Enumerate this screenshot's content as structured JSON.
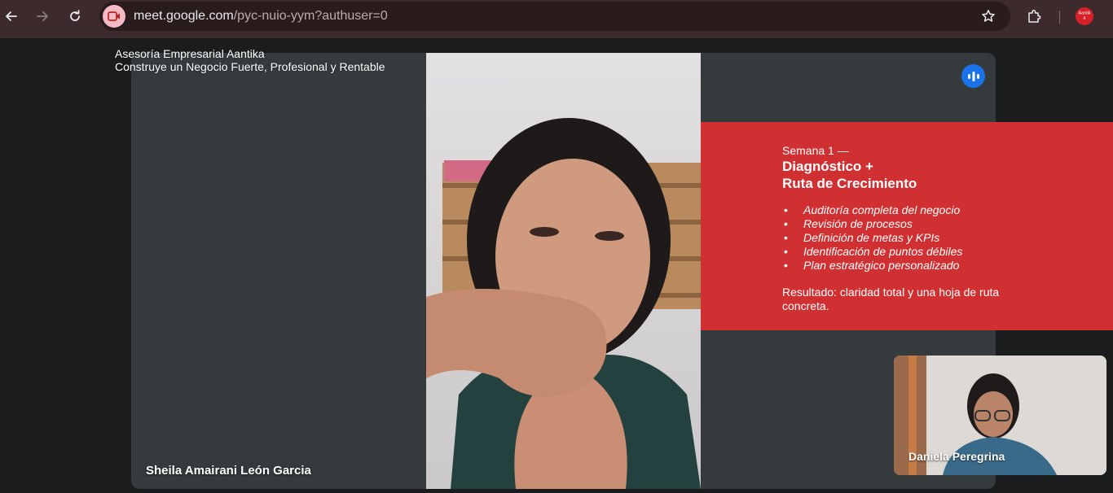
{
  "browser": {
    "back_icon": "arrow-left-icon",
    "forward_icon": "arrow-right-icon",
    "reload_icon": "reload-icon",
    "url_host": "meet.google.com",
    "url_path": "/pyc-nuio-yym?authuser=0",
    "bookmark_icon": "star-icon",
    "extensions_icon": "puzzle-icon",
    "profile_label": "Aantika"
  },
  "meeting": {
    "brand_line1": "Asesoría Empresarial Aantika",
    "brand_line2": "Construye un Negocio Fuerte, Profesional y Rentable",
    "main_participant": "Sheila Amairani León Garcia",
    "self_participant": "Daniela Peregrina",
    "speaking_icon": "audio-level-icon"
  },
  "slide": {
    "week_label": "Semana 1 —",
    "title_line1": "Diagnóstico +",
    "title_line2": "Ruta de Crecimiento",
    "bullets": [
      "Auditoría completa del negocio",
      "Revisión de procesos",
      "Definición de metas y KPIs",
      "Identificación de puntos débiles",
      "Plan estratégico personalizado"
    ],
    "result": "Resultado: claridad total y una hoja de ruta concreta."
  },
  "colors": {
    "chrome_bg": "#3d2a2c",
    "omnibox_bg": "#2a1b1d",
    "tile_bg": "#353a3d",
    "panel_red": "#d03032",
    "speaker_blue": "#1a73e8"
  }
}
